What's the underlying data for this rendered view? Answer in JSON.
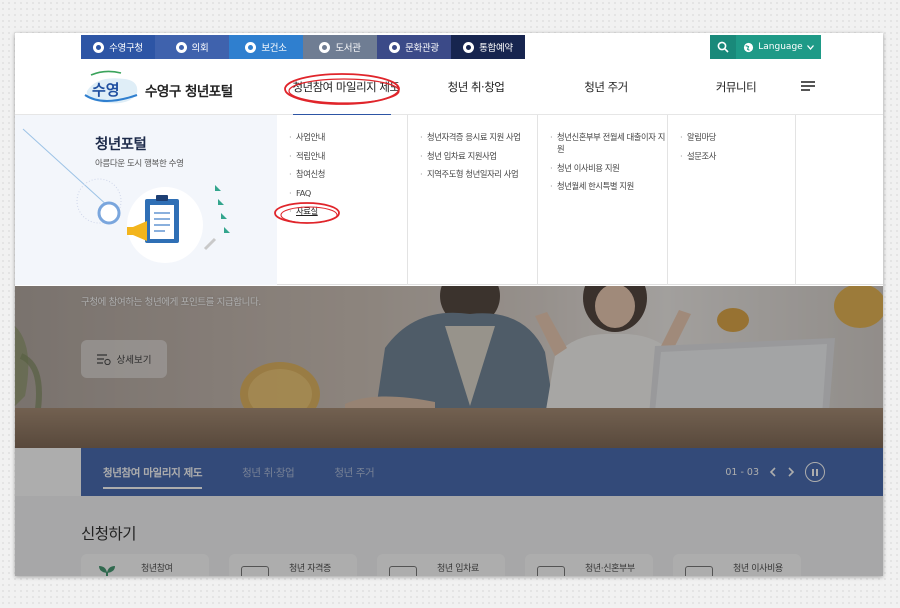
{
  "util_tabs": [
    {
      "label": "수영구청",
      "icon": "building-icon"
    },
    {
      "label": "의회",
      "icon": "assembly-icon"
    },
    {
      "label": "보건소",
      "icon": "health-cross-icon"
    },
    {
      "label": "도서관",
      "icon": "graduation-cap-icon"
    },
    {
      "label": "문화관광",
      "icon": "location-pin-icon"
    },
    {
      "label": "통합예약",
      "icon": "clock-icon"
    }
  ],
  "language_label": "Language",
  "site_title": "수영구 청년포털",
  "logo_text": "수영",
  "gnb": [
    {
      "label": "청년참여 마일리지 제도",
      "active": true
    },
    {
      "label": "청년 취·창업"
    },
    {
      "label": "청년 주거"
    },
    {
      "label": "커뮤니티"
    }
  ],
  "mega": {
    "title": "청년포털",
    "subtitle": "아름다운 도시 행복한 수영",
    "columns": [
      [
        "사업안내",
        "적립안내",
        "참여신청",
        "FAQ",
        "자료실"
      ],
      [
        "청년자격증 응시료 지원 사업",
        "청년 입차료 지원사업",
        "지역주도형 청년일자리 사업"
      ],
      [
        "청년신혼부부 전월세 대출이자 지원",
        "청년 이사비용 지원",
        "청년월세 한시특별 지원"
      ],
      [
        "알림마당",
        "설문조사"
      ]
    ]
  },
  "hero": {
    "text": "구청에 참여하는 청년에게 포인트를 지급합니다.",
    "detail_label": "상세보기"
  },
  "slider": {
    "tabs": [
      "청년참여 마일리지 제도",
      "청년 취·창업",
      "청년 주거"
    ],
    "counter": "01 - 03"
  },
  "apply": {
    "title": "신청하기",
    "cards": [
      "청년참여",
      "청년 자격증",
      "청년 입차료",
      "청년·신혼부부",
      "청년 이사비용"
    ]
  },
  "colors": {
    "primary": "#2d55a5",
    "search": "#19897a",
    "language": "#1e9a87",
    "annotation": "#e0252b"
  }
}
